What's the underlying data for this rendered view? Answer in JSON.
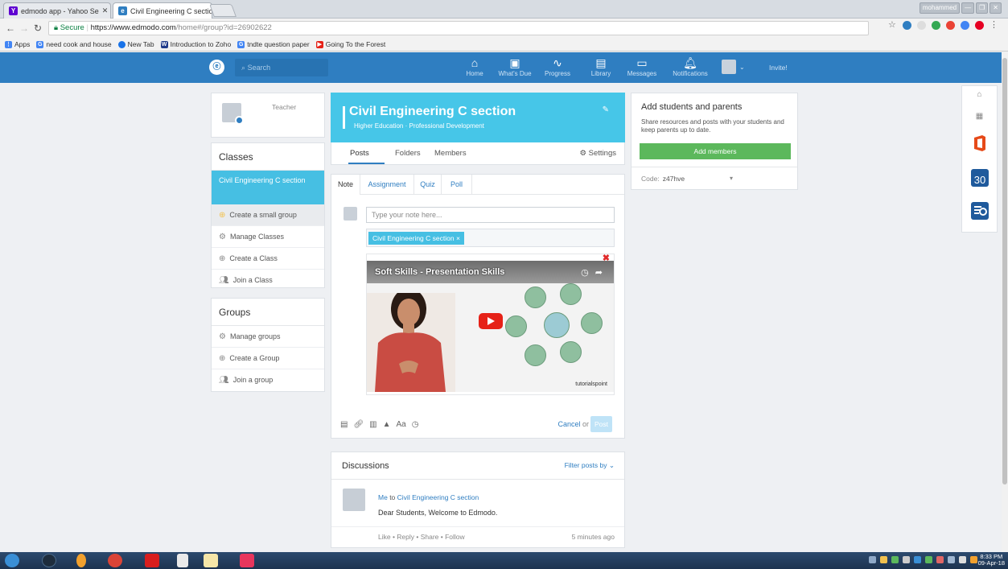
{
  "browser": {
    "tabs": [
      {
        "label": "edmodo app - Yahoo Se",
        "active": false
      },
      {
        "label": "Civil Engineering C sectio",
        "active": true
      }
    ],
    "user_chip": "mohammed",
    "url_secure": "Secure",
    "url_host": "https://www.edmodo.com",
    "url_path": "/home#/group?id=26902622",
    "bookmarks": [
      "Apps",
      "need cook and house",
      "New Tab",
      "Introduction to Zoho",
      "tndte question paper",
      "Going To the Forest"
    ]
  },
  "topnav": {
    "search_placeholder": "Search",
    "items": [
      {
        "label": "Home",
        "icon": "home-icon"
      },
      {
        "label": "What's Due",
        "icon": "calendar-icon"
      },
      {
        "label": "Progress",
        "icon": "pulse-icon"
      },
      {
        "label": "Library",
        "icon": "library-icon"
      },
      {
        "label": "Messages",
        "icon": "chat-icon"
      },
      {
        "label": "Notifications",
        "icon": "bell-icon"
      }
    ],
    "invite": "Invite!"
  },
  "profile": {
    "role": "Teacher"
  },
  "classes": {
    "heading": "Classes",
    "selected": "Civil Engineering C section",
    "items": [
      "Create a small group",
      "Manage Classes",
      "Create a Class",
      "Join a Class"
    ]
  },
  "groups": {
    "heading": "Groups",
    "items": [
      "Manage groups",
      "Create a Group",
      "Join a group"
    ]
  },
  "group": {
    "title": "Civil Engineering C section",
    "subtitle": "Higher Education · Professional Development",
    "tabs": [
      "Posts",
      "Folders",
      "Members"
    ],
    "settings": "Settings"
  },
  "composer": {
    "tabs": [
      "Note",
      "Assignment",
      "Quiz",
      "Poll"
    ],
    "placeholder": "Type your note here...",
    "recipient": "Civil Engineering C section",
    "video_title": "Soft Skills - Presentation Skills",
    "video_channel": "tutorialspoint",
    "cancel": "Cancel",
    "or": "or",
    "post": "Post"
  },
  "discussions": {
    "heading": "Discussions",
    "filter": "Filter posts by",
    "post": {
      "author": "Me",
      "to": "to",
      "group": "Civil Engineering C section",
      "text": "Dear Students, Welcome to Edmodo.",
      "actions": "Like • Reply • Share • Follow",
      "time": "5 minutes ago"
    }
  },
  "invite_card": {
    "title": "Add students and parents",
    "desc": "Share resources and posts with your students and keep parents up to date.",
    "button": "Add members",
    "code_label": "Code:",
    "code": "z47hve"
  },
  "taskbar": {
    "time": "8:33 PM",
    "date": "09-Apr-18"
  },
  "colors": {
    "nav": "#2f7ec1",
    "accent": "#46c6e8",
    "green": "#5cb85c"
  }
}
